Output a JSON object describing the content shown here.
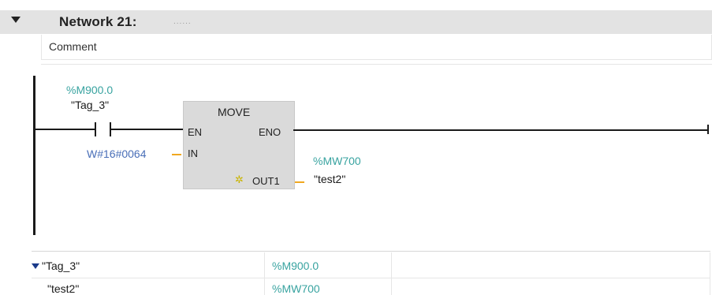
{
  "network": {
    "title": "Network 21:",
    "title_placeholder": "......",
    "comment": "Comment"
  },
  "ladder": {
    "contact": {
      "address": "%M900.0",
      "symbol": "\"Tag_3\""
    },
    "move_block": {
      "title": "MOVE",
      "pins": {
        "en": "EN",
        "eno": "ENO",
        "in": "IN",
        "out1": "OUT1"
      },
      "in_value": "W#16#0064",
      "out_address": "%MW700",
      "out_symbol": "\"test2\""
    }
  },
  "tag_table": {
    "rows": [
      {
        "symbol": "\"Tag_3\"",
        "address": "%M900.0",
        "expanded": true
      },
      {
        "symbol": "\"test2\"",
        "address": "%MW700"
      }
    ]
  },
  "colors": {
    "address_teal": "#38a3a0",
    "constant_blue": "#4a6fb8",
    "pin_stub_orange": "#f0a820",
    "block_fill": "#dadada",
    "header_fill": "#e3e3e3"
  }
}
